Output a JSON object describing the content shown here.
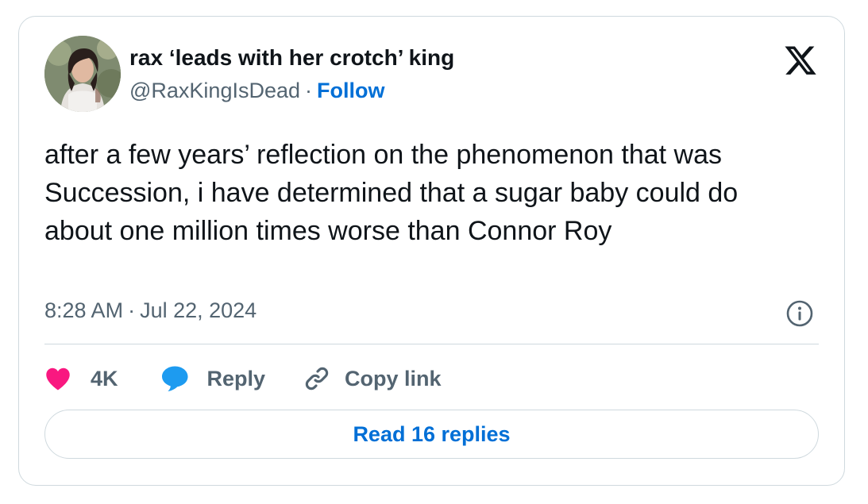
{
  "author": {
    "display_name": "rax ‘leads with her crotch’ king",
    "handle": "@RaxKingIsDead",
    "separator": "·",
    "follow_label": "Follow"
  },
  "tweet": {
    "text": "after a few years’ reflection on the phenomenon that was Succession, i have determined that a sugar baby could do about one million times worse than Connor Roy",
    "time": "8:28 AM",
    "separator": "·",
    "date": "Jul 22, 2024"
  },
  "actions": {
    "like_count": "4K",
    "reply_label": "Reply",
    "copy_link_label": "Copy link"
  },
  "read_replies_label": "Read 16 replies",
  "icons": {
    "platform_logo": "x-logo-icon",
    "info": "info-icon",
    "like": "heart-icon",
    "reply": "speech-bubble-icon",
    "copy_link": "link-icon"
  },
  "colors": {
    "text_primary": "#0f1419",
    "text_secondary": "#536471",
    "link": "#006fd6",
    "heart": "#f91880",
    "reply_bubble": "#1d9bf0",
    "border": "#cfd9de"
  }
}
